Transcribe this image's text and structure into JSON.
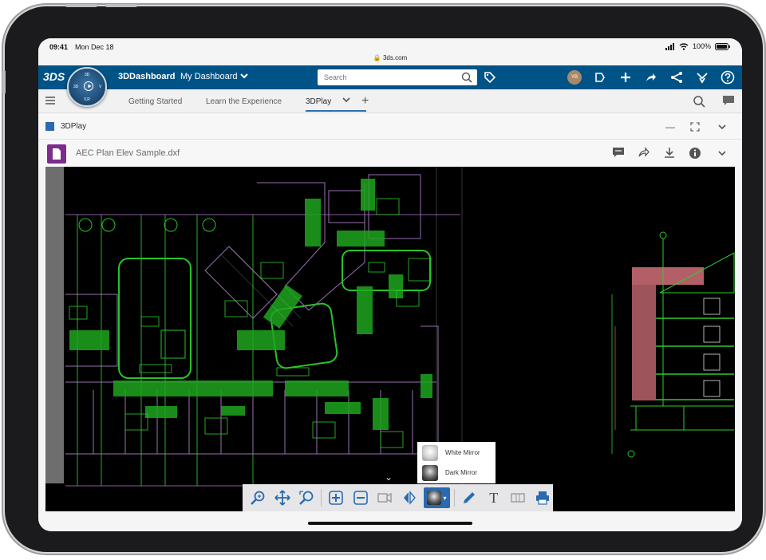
{
  "status": {
    "time": "09:41",
    "date": "Mon Dec 18",
    "url": "3ds.com",
    "battery": "100%"
  },
  "topbar": {
    "logo": "3DS",
    "brand": "3DDashboard",
    "dashboard": "My Dashboard",
    "search_placeholder": "Search",
    "avatar_initials": "YB",
    "compass_labels": {
      "top": "3D",
      "left": "3D",
      "right": "V",
      "bottom": "V,R"
    }
  },
  "tabs": {
    "items": [
      "Getting Started",
      "Learn the Experience",
      "3DPlay"
    ],
    "active": "3DPlay"
  },
  "widget": {
    "title": "3DPlay"
  },
  "document": {
    "title": "AEC Plan Elev Sample.dxf"
  },
  "mirror_menu": {
    "items": [
      "White Mirror",
      "Dark Mirror"
    ]
  },
  "colors": {
    "topbar": "#005386",
    "accent": "#2b6fb0",
    "doc_icon": "#7c2d8c",
    "cad_green": "#2ecc2e",
    "cad_purple": "#8a5aa0",
    "cad_red": "#c85050"
  }
}
